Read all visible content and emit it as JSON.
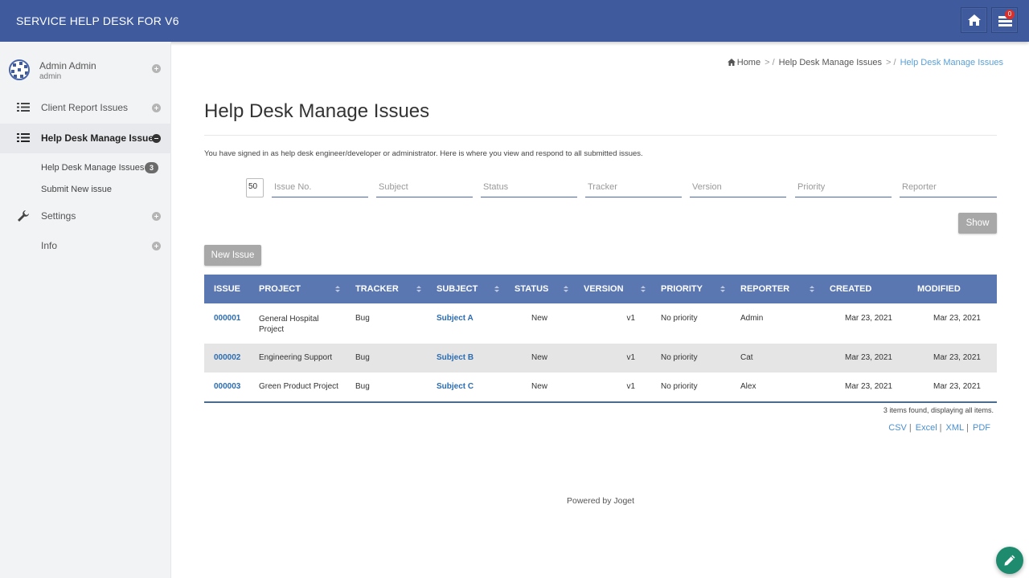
{
  "header": {
    "brand": "SERVICE HELP DESK FOR V6",
    "inbox_count": "0"
  },
  "sidebar": {
    "user": {
      "name": "Admin Admin",
      "id": "admin"
    },
    "items": [
      {
        "label": "Client Report Issues"
      },
      {
        "label": "Help Desk Manage Issues"
      },
      {
        "label": "Settings"
      },
      {
        "label": "Info"
      }
    ],
    "subitems": [
      {
        "label": "Help Desk Manage Issues",
        "count": "3"
      },
      {
        "label": "Submit New issue"
      }
    ]
  },
  "breadcrumb": {
    "home": "Home",
    "parent": "Help Desk Manage Issues",
    "current": "Help Desk Manage Issues"
  },
  "page": {
    "title": "Help Desk Manage Issues",
    "intro": "You have signed in as help desk engineer/developer or administrator. Here is where you view and respond to all submitted issues."
  },
  "filters": {
    "page_size": "50",
    "issue_no": "Issue No.",
    "subject": "Subject",
    "status": "Status",
    "tracker": "Tracker",
    "version": "Version",
    "priority": "Priority",
    "reporter": "Reporter"
  },
  "buttons": {
    "show": "Show",
    "new_issue": "New Issue"
  },
  "table": {
    "columns": [
      "ISSUE",
      "PROJECT",
      "TRACKER",
      "SUBJECT",
      "STATUS",
      "VERSION",
      "PRIORITY",
      "REPORTER",
      "CREATED",
      "MODIFIED"
    ],
    "rows": [
      {
        "issue": "000001",
        "project": "General Hospital Project",
        "tracker": "Bug",
        "subject": "Subject A",
        "status": "New",
        "version": "v1",
        "priority": "No priority",
        "reporter": "Admin",
        "created": "Mar 23, 2021",
        "modified": "Mar 23, 2021"
      },
      {
        "issue": "000002",
        "project": "Engineering Support",
        "tracker": "Bug",
        "subject": "Subject B",
        "status": "New",
        "version": "v1",
        "priority": "No priority",
        "reporter": "Cat",
        "created": "Mar 23, 2021",
        "modified": "Mar 23, 2021"
      },
      {
        "issue": "000003",
        "project": "Green Product Project",
        "tracker": "Bug",
        "subject": "Subject C",
        "status": "New",
        "version": "v1",
        "priority": "No priority",
        "reporter": "Alex",
        "created": "Mar 23, 2021",
        "modified": "Mar 23, 2021"
      }
    ],
    "found_text": "3 items found, displaying all items."
  },
  "exports": [
    "CSV",
    "Excel",
    "XML",
    "PDF"
  ],
  "footer": {
    "powered": "Powered by Joget"
  },
  "colors": {
    "header": "#3f5b9d",
    "table_header": "#5a77b2",
    "link": "#2b6cb0",
    "fab": "#1e8a6e"
  }
}
